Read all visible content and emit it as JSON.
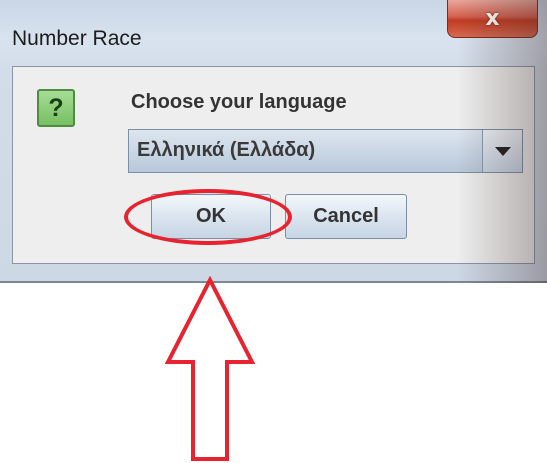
{
  "window": {
    "title": "Number Race",
    "close_glyph": "x"
  },
  "dialog": {
    "icon_glyph": "?",
    "prompt": "Choose your language",
    "language_select": {
      "selected_value": "Ελληνικά (Ελλάδα)"
    },
    "ok_label": "OK",
    "cancel_label": "Cancel"
  },
  "annotation": {
    "highlight_color": "#e8232f",
    "arrow_icon": "up-arrow-icon"
  },
  "colors": {
    "close_button": "#c23b23",
    "question_icon": "#76c062"
  }
}
